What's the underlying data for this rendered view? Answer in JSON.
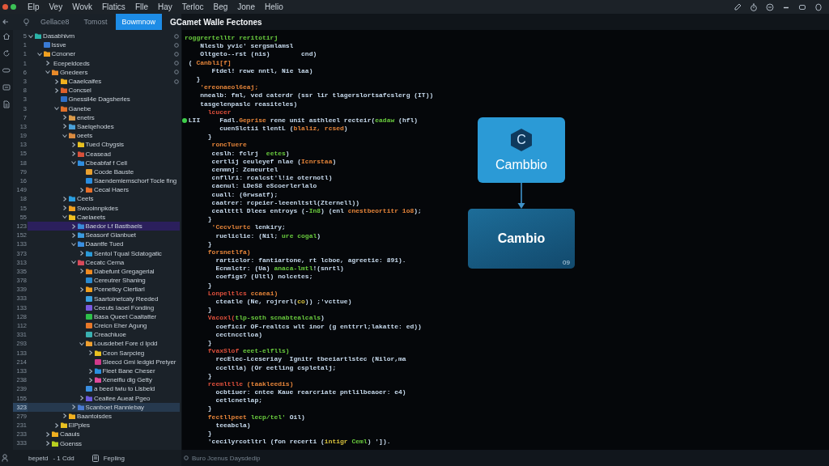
{
  "menu_bar": {
    "items": [
      "Elp",
      "Vey",
      "Wovk",
      "Flatics",
      "Flle",
      "Hay",
      "Terloc",
      "Beg",
      "Jone",
      "Helio"
    ]
  },
  "tab_bar": {
    "tabs": [
      {
        "label": "Gellace8",
        "selected": false
      },
      {
        "label": "Tomost",
        "selected": false
      },
      {
        "label": "Bowmnow",
        "selected": true
      }
    ],
    "editor_title": "GCamet Walle Fectones"
  },
  "sidebar": {
    "tree": [
      {
        "number": "5",
        "label": "Dasabhivm",
        "kind": "folder",
        "color": "#2bb3a8",
        "expanded": true,
        "selected": false,
        "focused": false,
        "children": [
          {
            "number": "1",
            "label": "Issve",
            "kind": "file",
            "color": "#3a7bd5",
            "selected": false,
            "focused": false
          },
          {
            "number": "1",
            "label": "Ccnoner",
            "kind": "folder",
            "color": "#f0a020",
            "expanded": true,
            "selected": false,
            "focused": false,
            "children": [
              {
                "number": "1",
                "label": "Ecepeldceds",
                "kind": "folder",
                "expanded": false,
                "selected": false,
                "focused": false
              },
              {
                "number": "6",
                "label": "Gnedeers",
                "kind": "folder",
                "color": "#e88a2a",
                "expanded": true,
                "selected": false,
                "focused": false,
                "children": [
                  {
                    "number": "3",
                    "label": "Caaelcaifes",
                    "kind": "folder",
                    "color": "#f2b01e",
                    "expanded": false,
                    "selected": false,
                    "focused": false
                  },
                  {
                    "number": "8",
                    "label": "Concsel",
                    "kind": "folder",
                    "color": "#e0602a",
                    "expanded": false,
                    "selected": false,
                    "focused": false
                  },
                  {
                    "number": "3",
                    "label": "Gnessil4e Dagsherles",
                    "kind": "file",
                    "color": "#2f6fc8",
                    "selected": false,
                    "focused": false
                  },
                  {
                    "number": "3",
                    "label": "Ganebe",
                    "kind": "folder",
                    "color": "#e0702a",
                    "expanded": true,
                    "selected": false,
                    "focused": false,
                    "children": [
                      {
                        "number": "7",
                        "label": "enetrs",
                        "kind": "folder",
                        "color": "#d89a4a",
                        "expanded": false,
                        "selected": false,
                        "focused": false
                      },
                      {
                        "number": "13",
                        "label": "Saelqehodes",
                        "kind": "folder",
                        "color": "#4aa0d8",
                        "expanded": false,
                        "selected": false,
                        "focused": false
                      },
                      {
                        "number": "19",
                        "label": "oeets",
                        "kind": "folder",
                        "color": "#d98a40",
                        "expanded": true,
                        "selected": false,
                        "focused": false,
                        "children": [
                          {
                            "number": "13",
                            "label": "Tued Cbygsis",
                            "kind": "folder",
                            "color": "#e8c020",
                            "expanded": false,
                            "selected": false,
                            "focused": false
                          },
                          {
                            "number": "15",
                            "label": "Ceasead",
                            "kind": "folder",
                            "color": "#d8503a",
                            "expanded": false,
                            "selected": false,
                            "focused": false
                          },
                          {
                            "number": "18",
                            "label": "Cbeabfaf f Cell",
                            "kind": "folder",
                            "color": "#2f8ee0",
                            "expanded": true,
                            "selected": false,
                            "focused": false,
                            "children": [
                              {
                                "number": "79",
                                "label": "Cocde Bauste",
                                "kind": "file",
                                "color": "#e8a030",
                                "selected": false,
                                "focused": false
                              },
                              {
                                "number": "16",
                                "label": "Saendemlemschorf Tocle fing",
                                "kind": "file",
                                "color": "#2a8de0",
                                "selected": false,
                                "focused": false
                              },
                              {
                                "number": "149",
                                "label": "Cecal Haers",
                                "kind": "folder",
                                "color": "#e8702a",
                                "expanded": false,
                                "selected": false,
                                "focused": false
                              }
                            ]
                          }
                        ]
                      },
                      {
                        "number": "18",
                        "label": "Ceets",
                        "kind": "folder",
                        "color": "#2a9ee0",
                        "expanded": false,
                        "selected": false,
                        "focused": false
                      },
                      {
                        "number": "15",
                        "label": "Swooinnpkdes",
                        "kind": "folder",
                        "color": "#f0a020",
                        "expanded": false,
                        "selected": false,
                        "focused": false
                      },
                      {
                        "number": "55",
                        "label": "Caelaeets",
                        "kind": "folder",
                        "color": "#f0c020",
                        "expanded": true,
                        "selected": false,
                        "focused": false,
                        "children": [
                          {
                            "number": "123",
                            "label": "Baedor Lf Bastbaels",
                            "kind": "folder",
                            "color": "#3a8ad8",
                            "expanded": false,
                            "selected": true,
                            "focused": false
                          },
                          {
                            "number": "152",
                            "label": "Seasonf Glanbuet",
                            "kind": "folder",
                            "color": "#3a9ae0",
                            "expanded": false,
                            "selected": false,
                            "focused": false
                          },
                          {
                            "number": "133",
                            "label": "Daantfe Tued",
                            "kind": "folder",
                            "color": "#3a8ee0",
                            "expanded": true,
                            "selected": false,
                            "focused": false,
                            "children": [
                              {
                                "number": "373",
                                "label": "Sentol Tqual Sclatogatic",
                                "kind": "folder",
                                "color": "#2a9ad8",
                                "expanded": false,
                                "selected": false,
                                "focused": false
                              }
                            ]
                          },
                          {
                            "number": "313",
                            "label": "Cecatc Cerna",
                            "kind": "folder",
                            "color": "#d84a5a",
                            "expanded": true,
                            "selected": false,
                            "focused": false,
                            "children": [
                              {
                                "number": "335",
                                "label": "Dabefunt Gregagerial",
                                "kind": "folder",
                                "color": "#f08a20",
                                "expanded": false,
                                "selected": false,
                                "focused": false
                              },
                              {
                                "number": "378",
                                "label": "Cereutrer Shaning",
                                "kind": "file",
                                "color": "#2a8ad0",
                                "selected": false,
                                "focused": false
                              },
                              {
                                "number": "339",
                                "label": "Pcenetlcy Clertiarl",
                                "kind": "folder",
                                "color": "#f0a020",
                                "expanded": false,
                                "selected": false,
                                "focused": false
                              },
                              {
                                "number": "333",
                                "label": "Saartoinetcaty Reeded",
                                "kind": "file",
                                "color": "#3aa0e0",
                                "selected": false,
                                "focused": false
                              },
                              {
                                "number": "133",
                                "label": "Ceeuts Iaoel Fonding",
                                "kind": "file",
                                "color": "#7a5ae0",
                                "selected": false,
                                "focused": false
                              },
                              {
                                "number": "128",
                                "label": "Basa Queet Caaltatter",
                                "kind": "file",
                                "color": "#2ec04a",
                                "selected": false,
                                "focused": false
                              },
                              {
                                "number": "112",
                                "label": "Creicn Eher Agung",
                                "kind": "file",
                                "color": "#e8782a",
                                "selected": false,
                                "focused": false
                              },
                              {
                                "number": "331",
                                "label": "Creachiuoe",
                                "kind": "file",
                                "color": "#3ab0b0",
                                "selected": false,
                                "focused": false
                              },
                              {
                                "number": "293",
                                "label": "Lousdebet Fore d Ipdd",
                                "kind": "folder",
                                "color": "#f0a030",
                                "expanded": true,
                                "selected": false,
                                "focused": false,
                                "children": [
                                  {
                                    "number": "133",
                                    "label": "Ceon Sarpcieg",
                                    "kind": "folder",
                                    "color": "#e8c020",
                                    "expanded": false,
                                    "selected": false,
                                    "focused": false
                                  },
                                  {
                                    "number": "214",
                                    "label": "Sleecd Gmi Iedgid Pretyer",
                                    "kind": "file",
                                    "color": "#d03a8a",
                                    "selected": false,
                                    "focused": false
                                  },
                                  {
                                    "number": "133",
                                    "label": "Fleet Bane Cheser",
                                    "kind": "folder",
                                    "color": "#2a90e0",
                                    "expanded": false,
                                    "selected": false,
                                    "focused": false
                                  },
                                  {
                                    "number": "238",
                                    "label": "Xeneifiu dig Getty",
                                    "kind": "folder",
                                    "color": "#e04a9a",
                                    "expanded": false,
                                    "selected": false,
                                    "focused": false
                                  }
                                ]
                              },
                              {
                                "number": "239",
                                "label": "a beed twiu to Llsbeld",
                                "kind": "file",
                                "color": "#3a8ee0",
                                "selected": false,
                                "focused": false
                              },
                              {
                                "number": "155",
                                "label": "Ceaitee Aueat Pgeo",
                                "kind": "folder",
                                "color": "#6a5ae0",
                                "expanded": false,
                                "selected": false,
                                "focused": false
                              }
                            ]
                          },
                          {
                            "number": "323",
                            "label": "Scanboet Rannlebay",
                            "kind": "folder",
                            "color": "#4a7ad0",
                            "expanded": false,
                            "selected": false,
                            "focused": true
                          }
                        ]
                      },
                      {
                        "number": "279",
                        "label": "Baantoisdes",
                        "kind": "folder",
                        "color": "#f0b020",
                        "expanded": false,
                        "selected": false,
                        "focused": false
                      }
                    ]
                  },
                  {
                    "number": "231",
                    "label": "ElPples",
                    "kind": "folder",
                    "color": "#e8c020",
                    "expanded": false,
                    "selected": false,
                    "focused": false
                  }
                ]
              },
              {
                "number": "233",
                "label": "Caauis",
                "kind": "folder",
                "color": "#f0b020",
                "expanded": false,
                "selected": false,
                "focused": false
              },
              {
                "number": "333",
                "label": "Goenss",
                "kind": "folder",
                "color": "#b8d020",
                "expanded": false,
                "selected": false,
                "focused": false
              }
            ]
          }
        ]
      }
    ]
  },
  "editor": {
    "lines": [
      {
        "breakpoint": false,
        "parts": [
          {
            "kind": "string",
            "text": "roggrertelltr reritotirj"
          }
        ]
      },
      {
        "breakpoint": false,
        "parts": [
          {
            "kind": "plain",
            "text": "    Nleslb yvic' sergsmlamsl"
          }
        ]
      },
      {
        "breakpoint": false,
        "parts": [
          {
            "kind": "plain",
            "text": "    Oltgeto--rst (nis)        cnd)"
          }
        ]
      },
      {
        "breakpoint": false,
        "parts": [
          {
            "kind": "plain",
            "text": " ( "
          },
          {
            "kind": "keyword",
            "text": "Canbli[f]"
          }
        ]
      },
      {
        "breakpoint": false,
        "parts": [
          {
            "kind": "plain",
            "text": "       Ftdel! rewe nntl, Nie laa)"
          }
        ]
      },
      {
        "breakpoint": false,
        "parts": [
          {
            "kind": "plain",
            "text": "   }"
          }
        ]
      },
      {
        "breakpoint": false,
        "parts": [
          {
            "kind": "keyword",
            "text": "    'ereonaeol6eaj;"
          }
        ]
      },
      {
        "breakpoint": false,
        "parts": [
          {
            "kind": "plain",
            "text": "    nnealb: fml, ved caterdr (ssr lir tlagerslortsafcslerg (IT))"
          }
        ]
      },
      {
        "breakpoint": false,
        "parts": [
          {
            "kind": "plain",
            "text": "    tasgelenpaslc reasiteles)"
          }
        ]
      },
      {
        "breakpoint": false,
        "parts": [
          {
            "kind": "error",
            "text": "      lcucer"
          }
        ]
      },
      {
        "breakpoint": true,
        "parts": [
          {
            "kind": "plain",
            "text": " LII     Fadl."
          },
          {
            "kind": "keyword",
            "text": "Geprise"
          },
          {
            "kind": "plain",
            "text": " rene unit asthleel recteir("
          },
          {
            "kind": "string",
            "text": "eadaw"
          },
          {
            "kind": "plain",
            "text": " (hfl)"
          }
        ]
      },
      {
        "breakpoint": false,
        "parts": [
          {
            "kind": "plain",
            "text": "         cuenSlctii tlentL ("
          },
          {
            "kind": "keyword",
            "text": "blaliz, rcsed"
          },
          {
            "kind": "plain",
            "text": ")"
          }
        ]
      },
      {
        "breakpoint": false,
        "parts": [
          {
            "kind": "plain",
            "text": "      }"
          }
        ]
      },
      {
        "breakpoint": false,
        "parts": [
          {
            "kind": "keyword",
            "text": "       roncTuere"
          }
        ]
      },
      {
        "breakpoint": false,
        "parts": [
          {
            "kind": "plain",
            "text": "       ceslh: fclrj  "
          },
          {
            "kind": "string",
            "text": "eetes"
          },
          {
            "kind": "plain",
            "text": ")"
          }
        ]
      },
      {
        "breakpoint": false,
        "parts": [
          {
            "kind": "plain",
            "text": "       certlij ceuleyef nlae ("
          },
          {
            "kind": "keyword",
            "text": "Icnrstaa"
          },
          {
            "kind": "plain",
            "text": ")"
          }
        ]
      },
      {
        "breakpoint": false,
        "parts": [
          {
            "kind": "plain",
            "text": "       cenmnj: Zcmeurtel"
          }
        ]
      },
      {
        "breakpoint": false,
        "parts": [
          {
            "kind": "plain",
            "text": "       cnfllri: rcalcst'l!ie oternotl)"
          }
        ]
      },
      {
        "breakpoint": false,
        "parts": [
          {
            "kind": "plain",
            "text": "       caenul: LDeS8 eScoerlerlalo"
          }
        ]
      },
      {
        "breakpoint": false,
        "parts": [
          {
            "kind": "plain",
            "text": "       cuall: (Grwsatf);"
          }
        ]
      },
      {
        "breakpoint": false,
        "parts": [
          {
            "kind": "plain",
            "text": "       caatrer: rcpeier-leeenltstl(Zternell))"
          }
        ]
      },
      {
        "breakpoint": false,
        "parts": [
          {
            "kind": "plain",
            "text": "       cealtttl Dlees entroys (-"
          },
          {
            "kind": "string",
            "text": "In8"
          },
          {
            "kind": "plain",
            "text": ") (enl "
          },
          {
            "kind": "keyword",
            "text": "cnestbeortitr 1o8"
          },
          {
            "kind": "plain",
            "text": ");"
          }
        ]
      },
      {
        "breakpoint": false,
        "parts": [
          {
            "kind": "plain",
            "text": "      }"
          }
        ]
      },
      {
        "breakpoint": false,
        "parts": [
          {
            "kind": "keyword",
            "text": "       'Cecvlurtc"
          },
          {
            "kind": "plain",
            "text": " lenkiry;"
          }
        ]
      },
      {
        "breakpoint": false,
        "parts": [
          {
            "kind": "plain",
            "text": "        rueliclie: (Nil; "
          },
          {
            "kind": "string",
            "text": "ure cogal"
          },
          {
            "kind": "plain",
            "text": ")"
          }
        ]
      },
      {
        "breakpoint": false,
        "parts": [
          {
            "kind": "plain",
            "text": "      }"
          }
        ]
      },
      {
        "breakpoint": false,
        "parts": [
          {
            "kind": "keyword",
            "text": "      forsnetlfa)"
          }
        ]
      },
      {
        "breakpoint": false,
        "parts": [
          {
            "kind": "plain",
            "text": "        rarticlor: fantiartone, rt lcboe, agreetie: 891)."
          }
        ]
      },
      {
        "breakpoint": false,
        "parts": [
          {
            "kind": "plain",
            "text": "        Ecnmlctr: (Ua) "
          },
          {
            "kind": "string",
            "text": "anaca-lmtl"
          },
          {
            "kind": "plain",
            "text": "!(snrtl)"
          }
        ]
      },
      {
        "breakpoint": false,
        "parts": [
          {
            "kind": "plain",
            "text": "        coefigs? (Ultl) nolcetes;"
          }
        ]
      },
      {
        "breakpoint": false,
        "parts": [
          {
            "kind": "plain",
            "text": "      }"
          }
        ]
      },
      {
        "breakpoint": false,
        "parts": [
          {
            "kind": "error",
            "text": "      Lonpeltlcs"
          },
          {
            "kind": "keyword",
            "text": " ccaeai)"
          }
        ]
      },
      {
        "breakpoint": false,
        "parts": [
          {
            "kind": "plain",
            "text": "        cteatle (Ne, rojrerl("
          },
          {
            "kind": "number",
            "text": "co"
          },
          {
            "kind": "plain",
            "text": ")) ;'vcttue)"
          }
        ]
      },
      {
        "breakpoint": false,
        "parts": [
          {
            "kind": "plain",
            "text": "      }"
          }
        ]
      },
      {
        "breakpoint": false,
        "parts": [
          {
            "kind": "error",
            "text": "      Vacoxl("
          },
          {
            "kind": "string",
            "text": "tlp-soth scnabtealcals"
          },
          {
            "kind": "plain",
            "text": ")"
          }
        ]
      },
      {
        "breakpoint": false,
        "parts": [
          {
            "kind": "plain",
            "text": "        coeficir OF-realtcs wlt inor (g enttrrl;lakatte: ed))"
          }
        ]
      },
      {
        "breakpoint": false,
        "parts": [
          {
            "kind": "plain",
            "text": "        cectncctloa)"
          }
        ]
      },
      {
        "breakpoint": false,
        "parts": [
          {
            "kind": "plain",
            "text": "      }"
          }
        ]
      },
      {
        "breakpoint": false,
        "parts": [
          {
            "kind": "error",
            "text": "      fvaxSlof"
          },
          {
            "kind": "string",
            "text": " eeet-elflls)"
          }
        ]
      },
      {
        "breakpoint": false,
        "parts": [
          {
            "kind": "plain",
            "text": "        recElec-Lceseriay  Ignitr tbeeiartlstec (Nilor,ma"
          }
        ]
      },
      {
        "breakpoint": false,
        "parts": [
          {
            "kind": "plain",
            "text": "        cceltla) (Or eetling cspletalj;"
          }
        ]
      },
      {
        "breakpoint": false,
        "parts": [
          {
            "kind": "plain",
            "text": "      }"
          }
        ]
      },
      {
        "breakpoint": false,
        "parts": [
          {
            "kind": "error",
            "text": "      reemltlle"
          },
          {
            "kind": "keyword",
            "text": " (taakleedis)"
          }
        ]
      },
      {
        "breakpoint": false,
        "parts": [
          {
            "kind": "plain",
            "text": "        ocbtiuer: cntee Kaue rearcriate pntlilbeaoer: e4)"
          }
        ]
      },
      {
        "breakpoint": false,
        "parts": [
          {
            "kind": "plain",
            "text": "        cetlcnetlap;"
          }
        ]
      },
      {
        "breakpoint": false,
        "parts": [
          {
            "kind": "plain",
            "text": "      }"
          }
        ]
      },
      {
        "breakpoint": false,
        "parts": [
          {
            "kind": "keyword",
            "text": "      fectllpeet"
          },
          {
            "kind": "string",
            "text": " lecp/tel'"
          },
          {
            "kind": "plain",
            "text": " Oil)"
          }
        ]
      },
      {
        "breakpoint": false,
        "parts": [
          {
            "kind": "plain",
            "text": "        teeabcla)"
          }
        ]
      },
      {
        "breakpoint": false,
        "parts": [
          {
            "kind": "plain",
            "text": "      }"
          }
        ]
      },
      {
        "breakpoint": false,
        "parts": [
          {
            "kind": "plain",
            "text": "      'cecilyrcotltrl (fon recerti ("
          },
          {
            "kind": "number",
            "text": "intigr"
          },
          {
            "kind": "string",
            "text": " Ceml"
          },
          {
            "kind": "plain",
            "text": ") '])."
          }
        ]
      }
    ],
    "status": "Buro Jcenus Daysdedip"
  },
  "diagram": {
    "nodes": [
      {
        "kind": "primary",
        "logo_letter": "C",
        "label": "Cambbio"
      },
      {
        "kind": "secondary",
        "label": "Cambio",
        "number": "09"
      }
    ]
  },
  "status_bar": {
    "items": [
      "bepetd",
      "- 1 Cdd",
      "Fepling"
    ]
  }
}
